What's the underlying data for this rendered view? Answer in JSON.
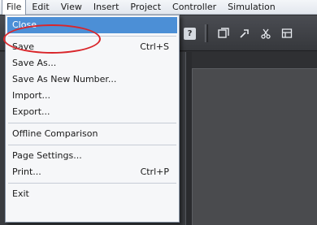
{
  "menubar": {
    "items": [
      {
        "label": "File",
        "name": "menu-file"
      },
      {
        "label": "Edit",
        "name": "menu-edit"
      },
      {
        "label": "View",
        "name": "menu-view"
      },
      {
        "label": "Insert",
        "name": "menu-insert"
      },
      {
        "label": "Project",
        "name": "menu-project"
      },
      {
        "label": "Controller",
        "name": "menu-controller"
      },
      {
        "label": "Simulation",
        "name": "menu-simulation"
      }
    ]
  },
  "file_menu": {
    "close": "Close",
    "save": "Save",
    "save_shortcut": "Ctrl+S",
    "save_as": "Save As...",
    "save_as_new_number": "Save As New Number...",
    "import": "Import...",
    "export": "Export...",
    "offline_comparison": "Offline Comparison",
    "page_settings": "Page Settings...",
    "print": "Print...",
    "print_shortcut": "Ctrl+P",
    "exit": "Exit"
  },
  "toolbar": {
    "help_glyph": "?",
    "icons": [
      "window-icon",
      "tools-icon",
      "cut-icon",
      "grid-icon"
    ]
  },
  "colors": {
    "highlight": "#4c8fd6",
    "annotation": "#d9262b",
    "workspace": "#2f3033"
  }
}
